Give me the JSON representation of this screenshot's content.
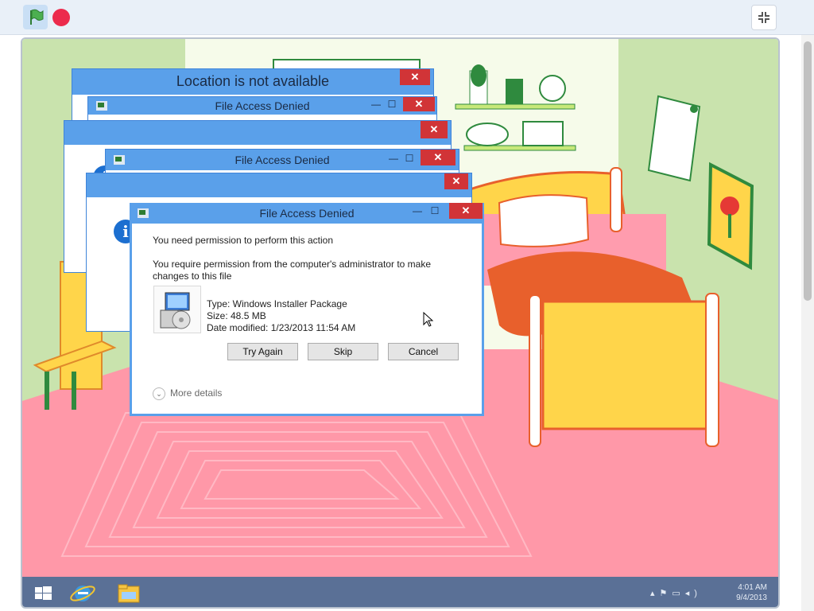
{
  "toolbar": {
    "flag_icon": "green-flag-icon",
    "stop_icon": "stop-icon",
    "fullscreen_icon": "fullscreen-exit-icon"
  },
  "dialogs": {
    "location": {
      "title": "Location is not available",
      "close": "✕"
    },
    "denied_1": {
      "title": "File Access Denied",
      "minimize": "—",
      "maximize": "☐",
      "close": "✕"
    },
    "blank_2": {
      "close": "✕"
    },
    "denied_3": {
      "title": "File Access Denied",
      "minimize": "—",
      "maximize": "☐",
      "close": "✕"
    },
    "blank_4": {
      "close": "✕"
    }
  },
  "main_dialog": {
    "title": "File Access Denied",
    "minimize": "—",
    "maximize": "☐",
    "close": "✕",
    "heading": "You need permission to perform this action",
    "message_line1": "You require permission from the computer's administrator to make",
    "message_line2": "changes to this file",
    "type": "Type: Windows Installer Package",
    "size": "Size: 48.5 MB",
    "date_modified": "Date modified: 1/23/2013 11:54 AM",
    "buttons": {
      "try_again": "Try Again",
      "skip": "Skip",
      "cancel": "Cancel"
    },
    "more_details": "More details",
    "info_glyph": "i"
  },
  "taskbar": {
    "icons": [
      "windows-start-icon",
      "internet-explorer-icon",
      "file-explorer-icon"
    ],
    "time": "4:01 AM",
    "date": "9/4/2013"
  },
  "colors": {
    "titlebar": "#5aa0ea",
    "close": "#d13437",
    "floor": "#ff98a8",
    "wall": "#eef5df",
    "taskbar": "#5a7096"
  }
}
